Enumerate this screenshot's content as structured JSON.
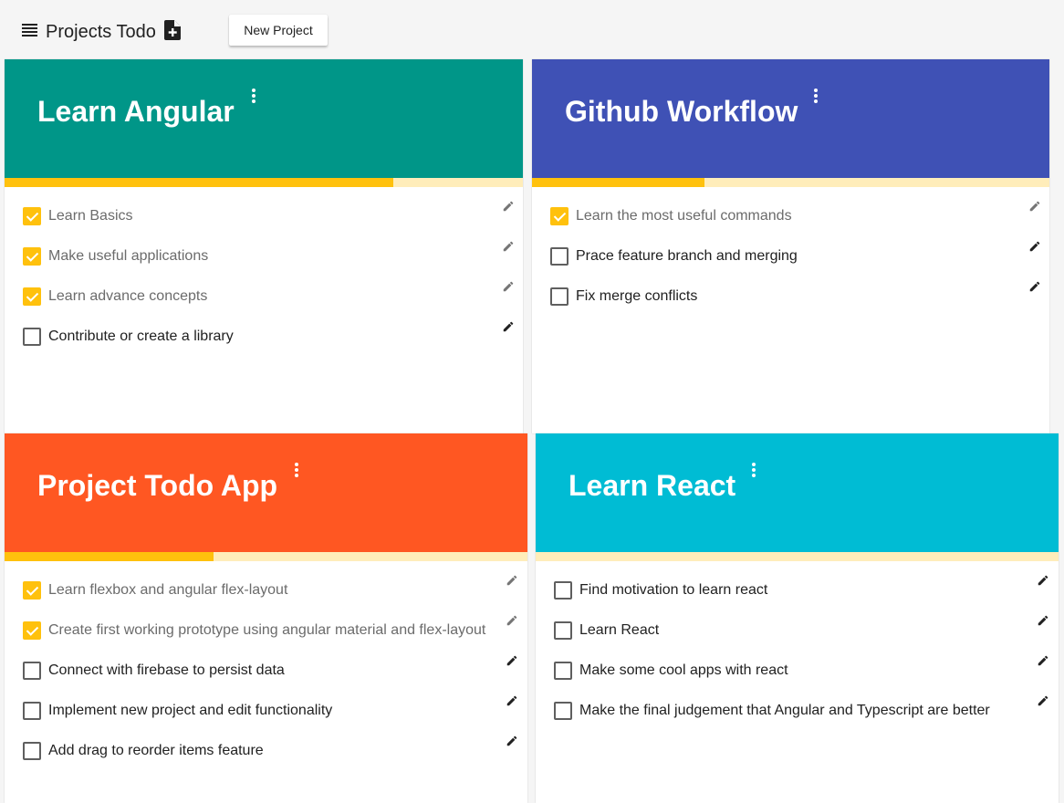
{
  "toolbar": {
    "menu_icon": "menu-icon",
    "title": "Projects Todo",
    "add_file_icon": "note-add-icon",
    "new_project_label": "New Project"
  },
  "colors": {
    "teal": "#009688",
    "indigo": "#3f51b5",
    "deep_orange": "#ff5722",
    "cyan": "#00bcd4",
    "progress_fill": "#ffc10d",
    "progress_track": "#ffedba"
  },
  "projects": [
    {
      "title": "Learn Angular",
      "color": "#009688",
      "progress": 0.75,
      "items": [
        {
          "label": "Learn Basics",
          "done": true
        },
        {
          "label": "Make useful applications",
          "done": true
        },
        {
          "label": "Learn advance concepts",
          "done": true
        },
        {
          "label": "Contribute or create a library",
          "done": false
        }
      ]
    },
    {
      "title": "Github Workflow",
      "color": "#3f51b5",
      "progress": 0.3333,
      "items": [
        {
          "label": "Learn the most useful commands",
          "done": true
        },
        {
          "label": "Prace feature branch and merging",
          "done": false
        },
        {
          "label": "Fix merge conflicts",
          "done": false
        }
      ]
    },
    {
      "title": "Project Todo App",
      "color": "#ff5722",
      "progress": 0.4,
      "items": [
        {
          "label": "Learn flexbox and angular flex-layout",
          "done": true
        },
        {
          "label": "Create first working prototype using angular material and flex-layout",
          "done": true
        },
        {
          "label": "Connect with firebase to persist data",
          "done": false
        },
        {
          "label": "Implement new project and edit functionality",
          "done": false
        },
        {
          "label": "Add drag to reorder items feature",
          "done": false
        }
      ]
    },
    {
      "title": "Learn React",
      "color": "#00bcd4",
      "progress": 0,
      "items": [
        {
          "label": "Find motivation to learn react",
          "done": false
        },
        {
          "label": "Learn React",
          "done": false
        },
        {
          "label": "Make some cool apps with react",
          "done": false
        },
        {
          "label": "Make the final judgement that Angular and Typescript are better",
          "done": false
        }
      ]
    }
  ]
}
